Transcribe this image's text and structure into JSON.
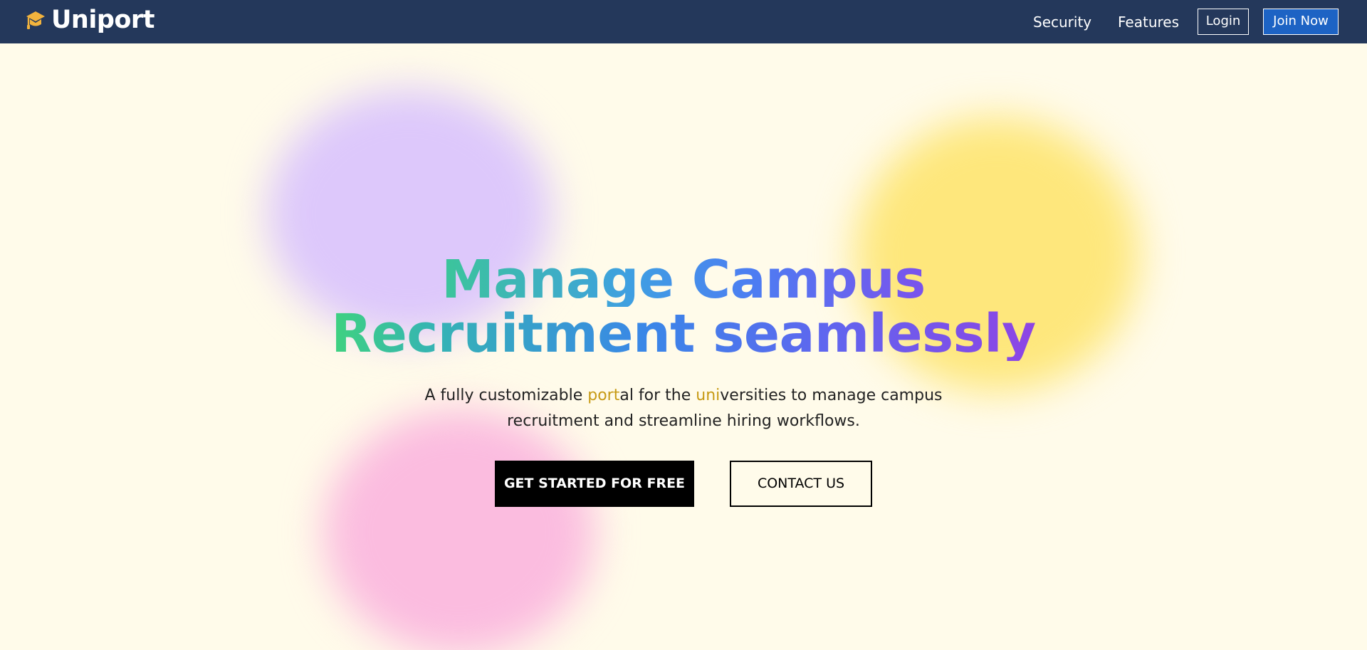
{
  "brand": {
    "name": "Uniport",
    "icon": "graduation-cap-icon",
    "icon_color": "#f2b33d"
  },
  "nav": {
    "links": [
      {
        "label": "Security"
      },
      {
        "label": "Features"
      }
    ],
    "login_label": "Login",
    "join_label": "Join Now"
  },
  "hero": {
    "headline_line1": "Manage Campus",
    "headline_line2": "Recruitment seamlessly",
    "subtitle": {
      "part1": "A fully customizable ",
      "highlight1": "port",
      "part2": "al for the ",
      "highlight2": "uni",
      "part3": "versities to manage campus recruitment and streamline hiring workflows."
    },
    "cta_primary": "GET STARTED FOR FREE",
    "cta_secondary": "CONTACT US"
  },
  "colors": {
    "navbar": "#24385b",
    "background": "#fffbea",
    "join_button": "#1d63c4",
    "highlight": "#c79a14",
    "blob_purple": "#ddc8fb",
    "blob_yellow": "#fee77c",
    "blob_pink": "#fbbcdf"
  }
}
